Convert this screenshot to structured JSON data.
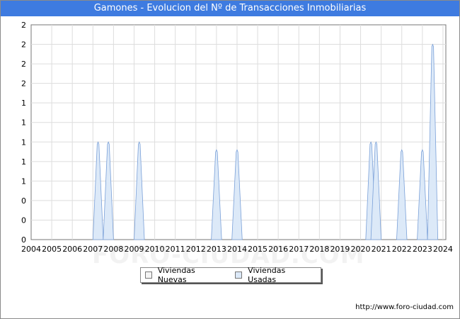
{
  "title": "Gamones - Evolucion del Nº de Transacciones Inmobiliarias",
  "footer_url": "http://www.foro-ciudad.com",
  "watermark": "FORO-CIUDAD.COM",
  "colors": {
    "title_bg": "#3e7be0",
    "nuevas_fill": "#f4f4f4",
    "usadas_fill": "#dce9f8",
    "usadas_stroke": "#7aa0d8",
    "grid": "#dddddd"
  },
  "chart_data": {
    "type": "area",
    "title": "Gamones - Evolucion del Nº de Transacciones Inmobiliarias",
    "xlabel": "",
    "ylabel": "",
    "x_ticks": [
      "2004",
      "2005",
      "2006",
      "2007",
      "2008",
      "2009",
      "2010",
      "2011",
      "2012",
      "2013",
      "2014",
      "2015",
      "2016",
      "2017",
      "2018",
      "2019",
      "2020",
      "2021",
      "2022",
      "2023",
      "2024"
    ],
    "y_tick_labels": [
      "0",
      "0",
      "0",
      "1",
      "1",
      "1",
      "1",
      "1",
      "2",
      "2",
      "2",
      "2"
    ],
    "ylim": [
      0,
      2.2
    ],
    "grid": true,
    "legend_position": "bottom-center",
    "series": [
      {
        "name": "Viviendas Nuevas",
        "points": []
      },
      {
        "name": "Viviendas Usadas",
        "points": [
          {
            "x": 2007.25,
            "y": 1
          },
          {
            "x": 2007.75,
            "y": 1
          },
          {
            "x": 2009.25,
            "y": 1
          },
          {
            "x": 2013.0,
            "y": 0.92
          },
          {
            "x": 2014.0,
            "y": 0.92
          },
          {
            "x": 2020.5,
            "y": 1
          },
          {
            "x": 2020.75,
            "y": 1
          },
          {
            "x": 2022.0,
            "y": 0.92
          },
          {
            "x": 2023.0,
            "y": 0.92
          },
          {
            "x": 2023.5,
            "y": 2
          }
        ]
      }
    ]
  }
}
